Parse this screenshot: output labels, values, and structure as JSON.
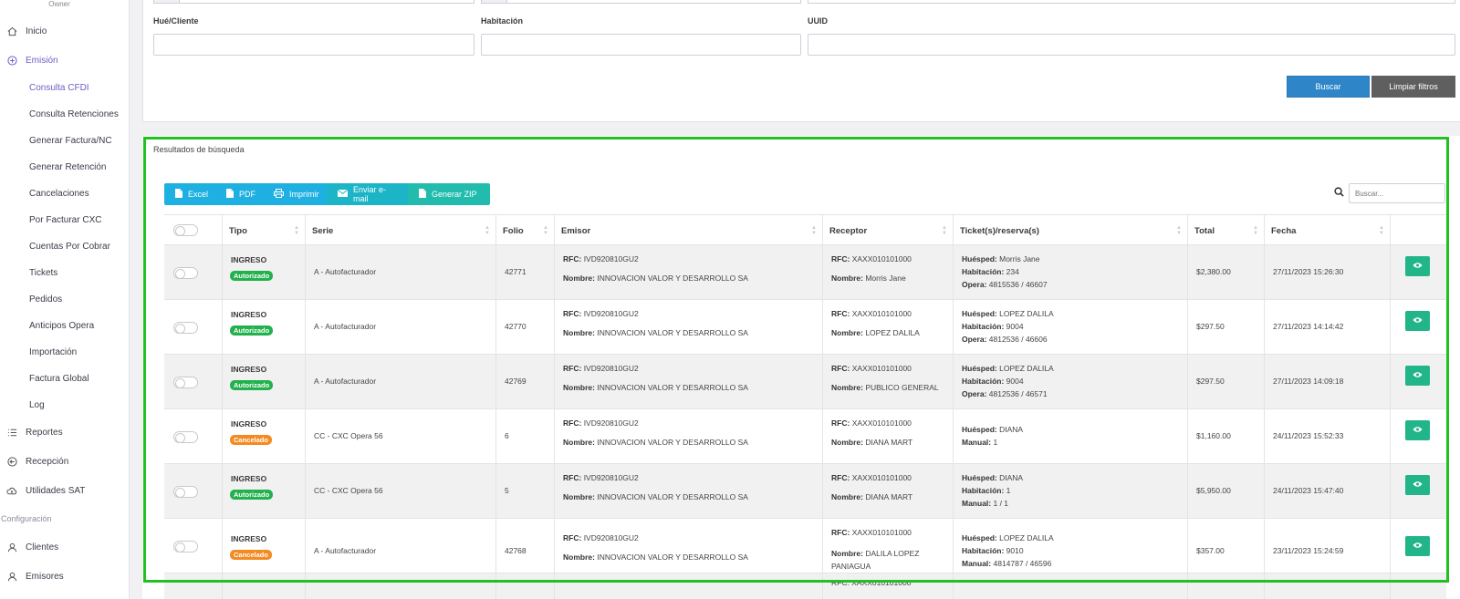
{
  "sidebar": {
    "owner_label": "Owner",
    "items": [
      {
        "label": "Inicio",
        "icon": "home-icon"
      },
      {
        "label": "Emisión",
        "icon": "plus-circle-icon"
      },
      {
        "label": "Reportes",
        "icon": "list-icon"
      },
      {
        "label": "Recepción",
        "icon": "arrow-circle-icon"
      },
      {
        "label": "Utilidades SAT",
        "icon": "cloud-icon"
      },
      {
        "label": "Clientes",
        "icon": "user-icon"
      },
      {
        "label": "Emisores",
        "icon": "user-icon"
      }
    ],
    "emision_sub": [
      "Consulta CFDI",
      "Consulta Retenciones",
      "Generar Factura/NC",
      "Generar Retención",
      "Cancelaciones",
      "Por Facturar CXC",
      "Cuentas Por Cobrar",
      "Tickets",
      "Pedidos",
      "Anticipos Opera",
      "Importación",
      "Factura Global",
      "Log"
    ],
    "config_heading": "Configuración"
  },
  "filters": {
    "huesped_label": "Hué/Cliente",
    "habitacion_label": "Habitación",
    "uuid_label": "UUID",
    "huesped_value": "",
    "habitacion_value": "",
    "uuid_value": "",
    "buscar_label": "Buscar",
    "limpiar_label": "Limpiar filtros"
  },
  "results": {
    "title": "Resultados de búsqueda",
    "toolbar": [
      "Excel",
      "PDF",
      "Imprimir",
      "Enviar e-mail",
      "Generar ZIP"
    ],
    "search_placeholder": "Buscar...",
    "columns": [
      "Tipo",
      "Serie",
      "Folio",
      "Emisor",
      "Receptor",
      "Ticket(s)/reserva(s)",
      "Total",
      "Fecha"
    ],
    "labels": {
      "rfc": "RFC:",
      "nombre": "Nombre:",
      "huesped": "Huésped:",
      "habitacion": "Habitación:",
      "opera": "Opera:",
      "manual": "Manual:"
    },
    "rows": [
      {
        "tipo": "INGRESO",
        "status": "Autorizado",
        "serie": "A - Autofacturador",
        "folio": "42771",
        "emisor_rfc": "IVD920810GU2",
        "emisor_nombre": "INNOVACION VALOR Y DESARROLLO SA",
        "receptor_rfc": "XAXX010101000",
        "receptor_nombre": "Morris Jane",
        "huesped": "Morris Jane",
        "habitacion": "234",
        "opera": "4815536 / 46607",
        "manual": "",
        "total": "$2,380.00",
        "fecha": "27/11/2023 15:26:30"
      },
      {
        "tipo": "INGRESO",
        "status": "Autorizado",
        "serie": "A - Autofacturador",
        "folio": "42770",
        "emisor_rfc": "IVD920810GU2",
        "emisor_nombre": "INNOVACION VALOR Y DESARROLLO SA",
        "receptor_rfc": "XAXX010101000",
        "receptor_nombre": "LOPEZ DALILA",
        "huesped": "LOPEZ DALILA",
        "habitacion": "9004",
        "opera": "4812536 / 46606",
        "manual": "",
        "total": "$297.50",
        "fecha": "27/11/2023 14:14:42"
      },
      {
        "tipo": "INGRESO",
        "status": "Autorizado",
        "serie": "A - Autofacturador",
        "folio": "42769",
        "emisor_rfc": "IVD920810GU2",
        "emisor_nombre": "INNOVACION VALOR Y DESARROLLO SA",
        "receptor_rfc": "XAXX010101000",
        "receptor_nombre": "PUBLICO GENERAL",
        "huesped": "LOPEZ DALILA",
        "habitacion": "9004",
        "opera": "4812536 / 46571",
        "manual": "",
        "total": "$297.50",
        "fecha": "27/11/2023 14:09:18"
      },
      {
        "tipo": "INGRESO",
        "status": "Cancelado",
        "serie": "CC - CXC Opera 56",
        "folio": "6",
        "emisor_rfc": "IVD920810GU2",
        "emisor_nombre": "INNOVACION VALOR Y DESARROLLO SA",
        "receptor_rfc": "XAXX010101000",
        "receptor_nombre": "DIANA MART",
        "huesped": "DIANA",
        "habitacion": "",
        "opera": "",
        "manual": "1",
        "total": "$1,160.00",
        "fecha": "24/11/2023 15:52:33"
      },
      {
        "tipo": "INGRESO",
        "status": "Autorizado",
        "serie": "CC - CXC Opera 56",
        "folio": "5",
        "emisor_rfc": "IVD920810GU2",
        "emisor_nombre": "INNOVACION VALOR Y DESARROLLO SA",
        "receptor_rfc": "XAXX010101000",
        "receptor_nombre": "DIANA MART",
        "huesped": "DIANA",
        "habitacion": "1",
        "opera": "",
        "manual": "1 / 1",
        "total": "$5,950.00",
        "fecha": "24/11/2023 15:47:40"
      },
      {
        "tipo": "INGRESO",
        "status": "Cancelado",
        "serie": "A - Autofacturador",
        "folio": "42768",
        "emisor_rfc": "IVD920810GU2",
        "emisor_nombre": "INNOVACION VALOR Y DESARROLLO SA",
        "receptor_rfc": "XAXX010101000",
        "receptor_nombre": "DALILA LOPEZ PANIAGUA",
        "huesped": "LOPEZ DALILA",
        "habitacion": "9010",
        "opera": "",
        "manual": "4814787 / 46596",
        "total": "$357.00",
        "fecha": "23/11/2023 15:24:59"
      }
    ],
    "partial_row_rfc": "RFC: XAXX010101000"
  },
  "colors": {
    "accent": "#6c5fc7",
    "outline": "#22c122",
    "authorized": "#22b14c",
    "cancelled": "#f38a22",
    "primary_button": "#2e86c8",
    "eye_button": "#22b58a"
  }
}
